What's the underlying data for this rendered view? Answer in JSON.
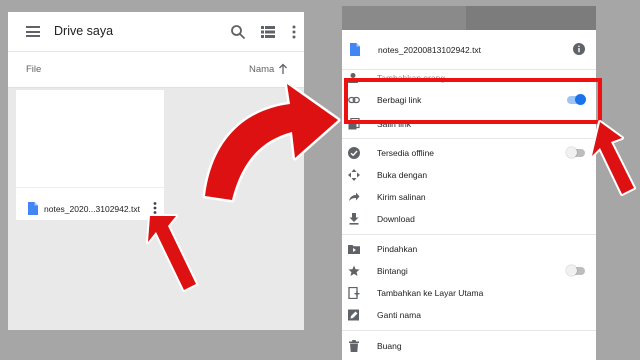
{
  "left": {
    "app_title": "Drive saya",
    "sort_label_file": "File",
    "sort_label_name": "Nama",
    "file_name": "notes_2020...3102942.txt"
  },
  "sheet": {
    "title": "notes_20200813102942.txt",
    "items": [
      {
        "label": "Tambahkan orang",
        "icon": "person-add-icon"
      },
      {
        "label": "Berbagi link",
        "icon": "link-icon",
        "toggle": "on"
      },
      {
        "label": "Salin link",
        "icon": "copy-icon"
      },
      {
        "label": "Tersedia offline",
        "icon": "offline-icon",
        "toggle": "off"
      },
      {
        "label": "Buka dengan",
        "icon": "open-with-icon"
      },
      {
        "label": "Kirim salinan",
        "icon": "share-icon"
      },
      {
        "label": "Download",
        "icon": "download-icon"
      },
      {
        "label": "Pindahkan",
        "icon": "move-folder-icon"
      },
      {
        "label": "Bintangi",
        "icon": "star-icon",
        "toggle": "off"
      },
      {
        "label": "Tambahkan ke Layar Utama",
        "icon": "add-home-icon"
      },
      {
        "label": "Ganti nama",
        "icon": "rename-icon"
      },
      {
        "label": "Buang",
        "icon": "trash-icon"
      }
    ]
  },
  "colors": {
    "highlight": "#ee1111",
    "accent": "#1a73e8",
    "doc_icon": "#4285f4"
  }
}
